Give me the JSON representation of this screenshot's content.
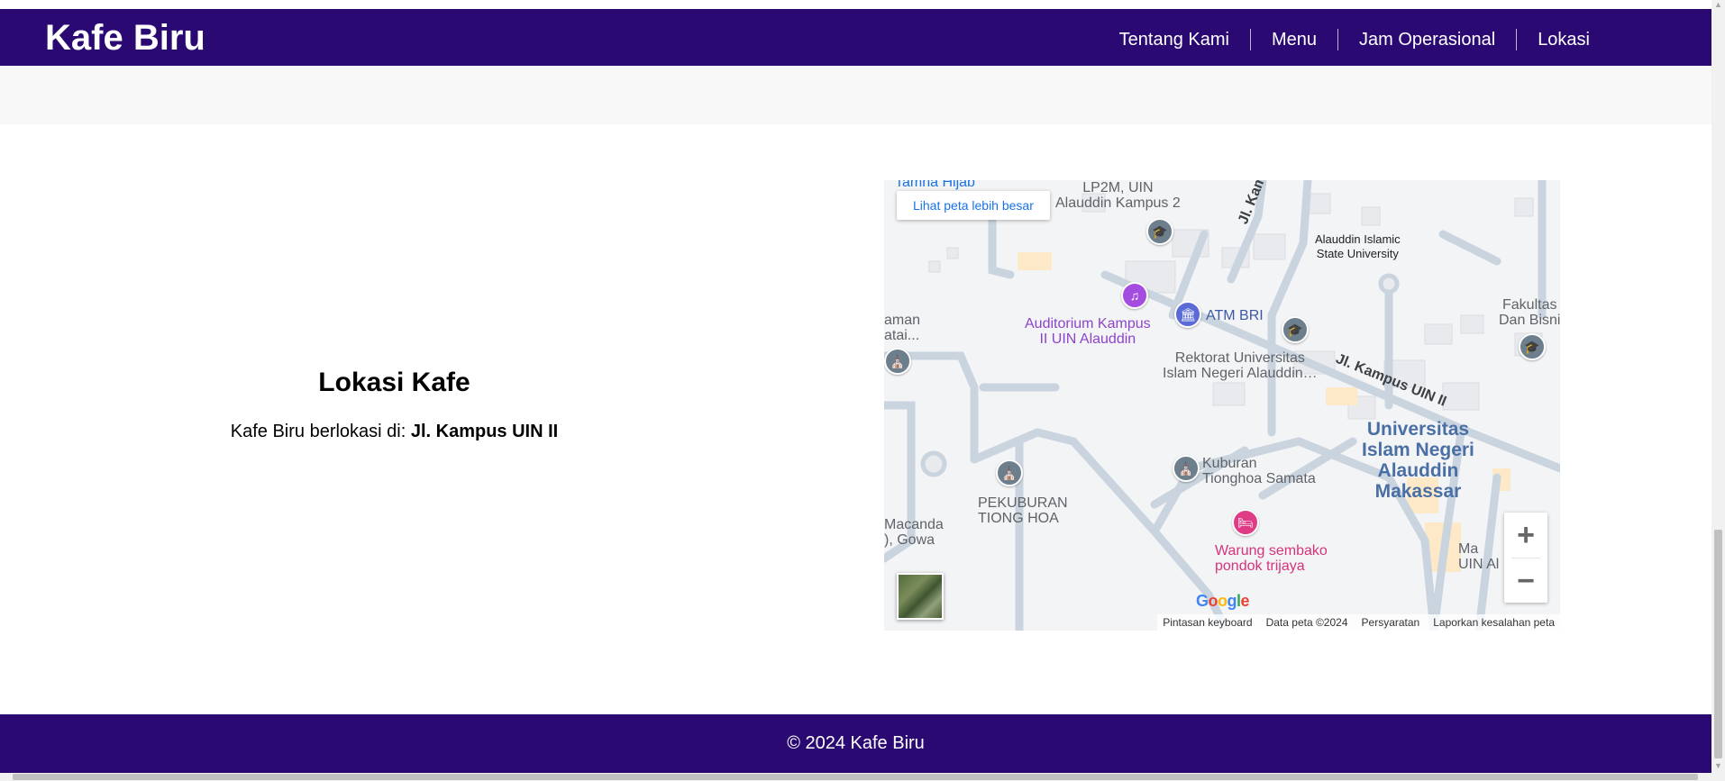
{
  "header": {
    "brand": "Kafe Biru",
    "nav": [
      "Tentang Kami",
      "Menu",
      "Jam Operasional",
      "Lokasi"
    ]
  },
  "location": {
    "title": "Lokasi Kafe",
    "prefix": "Kafe Biru berlokasi di: ",
    "address": "Jl. Kampus UIN II"
  },
  "map": {
    "larger_link": "Lihat peta lebih besar",
    "labels": {
      "lp2m": "LP2M, UIN\nAlauddin Kampus 2",
      "alauddin_islamic": "Alauddin Islamic\nState University",
      "auditorium": "Auditorium Kampus\nII UIN Alauddin",
      "atm": "ATM BRI",
      "rektorat": "Rektorat Universitas\nIslam Negeri Alauddin…",
      "fakultas": "Fakultas\nDan Bisni",
      "uin_big": "Universitas\nIslam Negeri\nAlauddin\nMakassar",
      "kuburan": "Kuburan\nTionghoa Samata",
      "pekuburan": "PEKUBURAN\nTIONG HOA",
      "warung": "Warung sembako\npondok trijaya",
      "macanda": "Macanda\n), Gowa",
      "aman": "aman\natai...",
      "uin_al": "Ma\nUIN Al    S",
      "tamna": "Tamna Hijab"
    },
    "roads": {
      "kampus_diag": "Jl. Kampus UIN",
      "kampus_ii": "Jl. Kampus UIN II"
    },
    "attribution": [
      "Pintasan keyboard",
      "Data peta ©2024",
      "Persyaratan",
      "Laporkan kesalahan peta"
    ],
    "zoom_in": "+",
    "zoom_out": "−",
    "google": "Google"
  },
  "footer": {
    "copyright": "© 2024 Kafe Biru"
  },
  "colors": {
    "brand_purple": "#2a0a72",
    "page_bg": "#ffffff",
    "strip_gray": "#f8f8f8"
  }
}
